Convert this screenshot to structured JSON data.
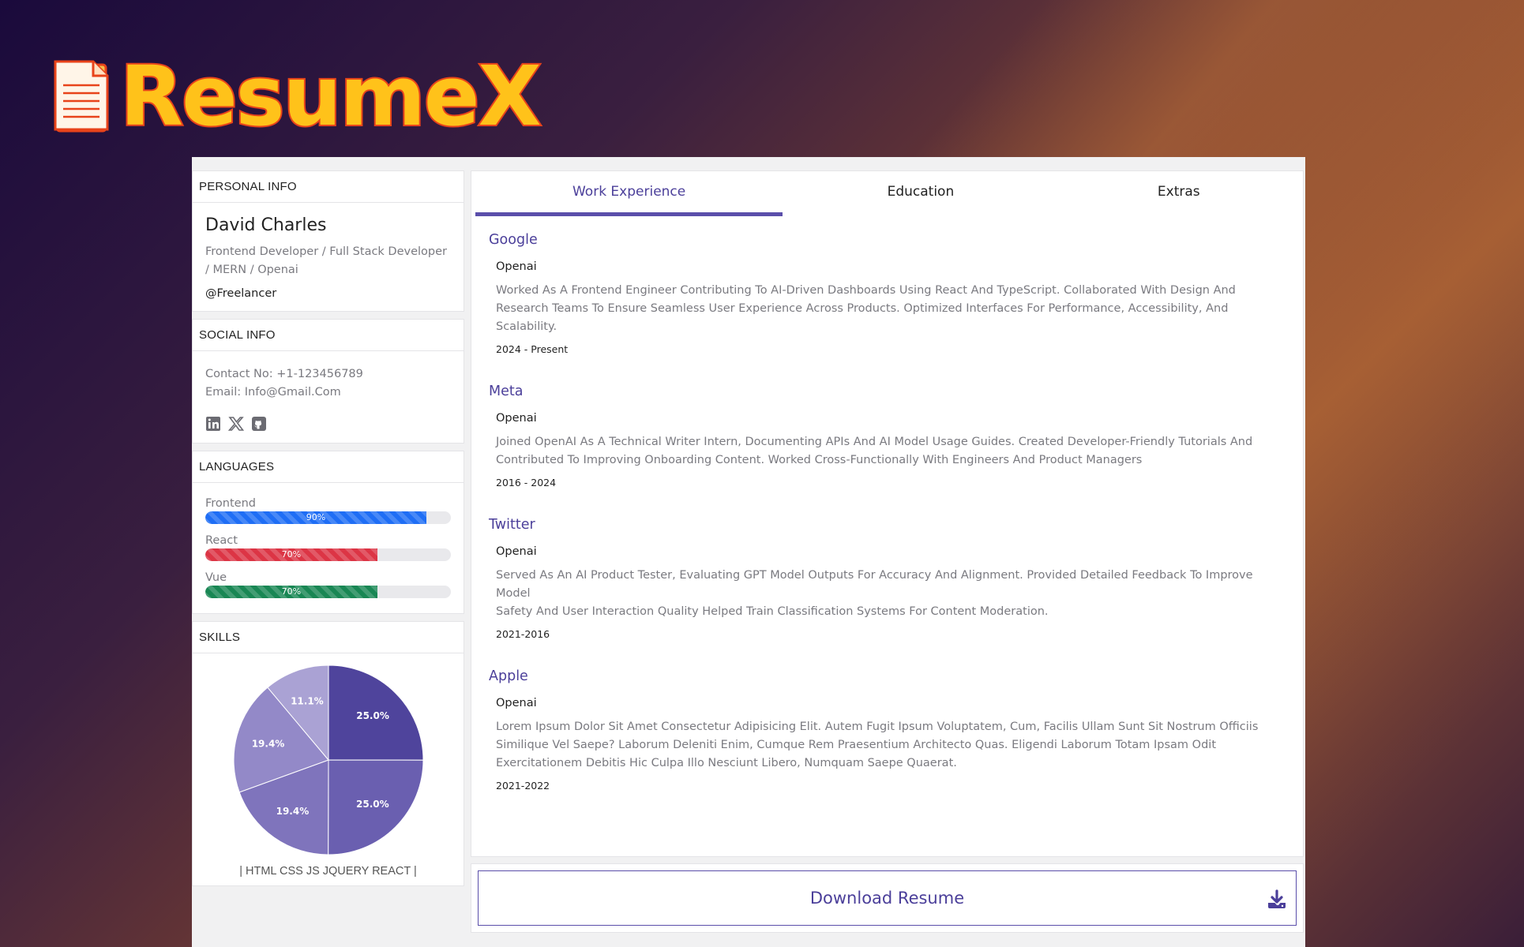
{
  "app": {
    "logo_text": "ResumeX"
  },
  "personal": {
    "header": "PERSONAL INFO",
    "name": "David Charles",
    "title_line1": "Frontend Developer / Full Stack Developer",
    "title_line2": "/ MERN / Openai",
    "handle": "@Freelancer"
  },
  "social": {
    "header": "SOCIAL INFO",
    "contact": "Contact No: +1-123456789",
    "email": "Email: Info@Gmail.Com",
    "icons": [
      "linkedin-icon",
      "x-twitter-icon",
      "github-icon"
    ]
  },
  "languages": {
    "header": "LANGUAGES",
    "items": [
      {
        "label": "Frontend",
        "percent": 90,
        "text": "90%",
        "color": "#1f6ef5"
      },
      {
        "label": "React",
        "percent": 70,
        "text": "70%",
        "color": "#dc3545"
      },
      {
        "label": "Vue",
        "percent": 70,
        "text": "70%",
        "color": "#198754"
      }
    ]
  },
  "skills": {
    "header": "SKILLS",
    "caption": "| HTML CSS JS JQUERY REACT |"
  },
  "chart_data": {
    "type": "pie",
    "categories": [
      "",
      "",
      "",
      "",
      ""
    ],
    "values": [
      25.0,
      25.0,
      19.4,
      19.4,
      11.1
    ],
    "labels": [
      "25.0%",
      "25.0%",
      "19.4%",
      "19.4%",
      "11.1%"
    ],
    "colors": [
      "#4f449c",
      "#6a5fb0",
      "#7f74bc",
      "#9389c8",
      "#aaa2d4"
    ]
  },
  "tabs": [
    {
      "label": "Work Experience",
      "active": true
    },
    {
      "label": "Education",
      "active": false
    },
    {
      "label": "Extras",
      "active": false
    }
  ],
  "jobs": [
    {
      "company": "Google",
      "role": "Openai",
      "desc_line1": "Worked As A Frontend Engineer Contributing To AI-Driven Dashboards Using React And TypeScript. Collaborated With Design And",
      "desc_line2": "Research Teams To Ensure Seamless User Experience Across Products. Optimized Interfaces For Performance, Accessibility, And Scalability.",
      "desc_line3": "",
      "dates": "2024 - Present"
    },
    {
      "company": "Meta",
      "role": "Openai",
      "desc_line1": "Joined OpenAI As A Technical Writer Intern, Documenting APIs And AI Model Usage Guides. Created Developer-Friendly Tutorials And",
      "desc_line2": "Contributed To Improving Onboarding Content. Worked Cross-Functionally With Engineers And Product Managers",
      "desc_line3": "",
      "dates": "2016 - 2024"
    },
    {
      "company": "Twitter",
      "role": "Openai",
      "desc_line1": "Served As An AI Product Tester, Evaluating GPT Model Outputs For Accuracy And Alignment. Provided Detailed Feedback To Improve Model",
      "desc_line2": "Safety And User Interaction Quality Helped Train Classification Systems For Content Moderation.",
      "desc_line3": "",
      "dates": "2021-2016"
    },
    {
      "company": "Apple",
      "role": "Openai",
      "desc_line1": "Lorem Ipsum Dolor Sit Amet Consectetur Adipisicing Elit. Autem Fugit Ipsum Voluptatem, Cum, Facilis Ullam Sunt Sit Nostrum Officiis",
      "desc_line2": "Similique Vel Saepe? Laborum Deleniti Enim, Cumque Rem Praesentium Architecto Quas. Eligendi Laborum Totam Ipsam Odit",
      "desc_line3": "Exercitationem Debitis Hic Culpa Illo Nesciunt Libero, Numquam Saepe Quaerat.",
      "dates": "2021-2022"
    }
  ],
  "download": {
    "label": "Download Resume",
    "icon": "download-icon"
  }
}
